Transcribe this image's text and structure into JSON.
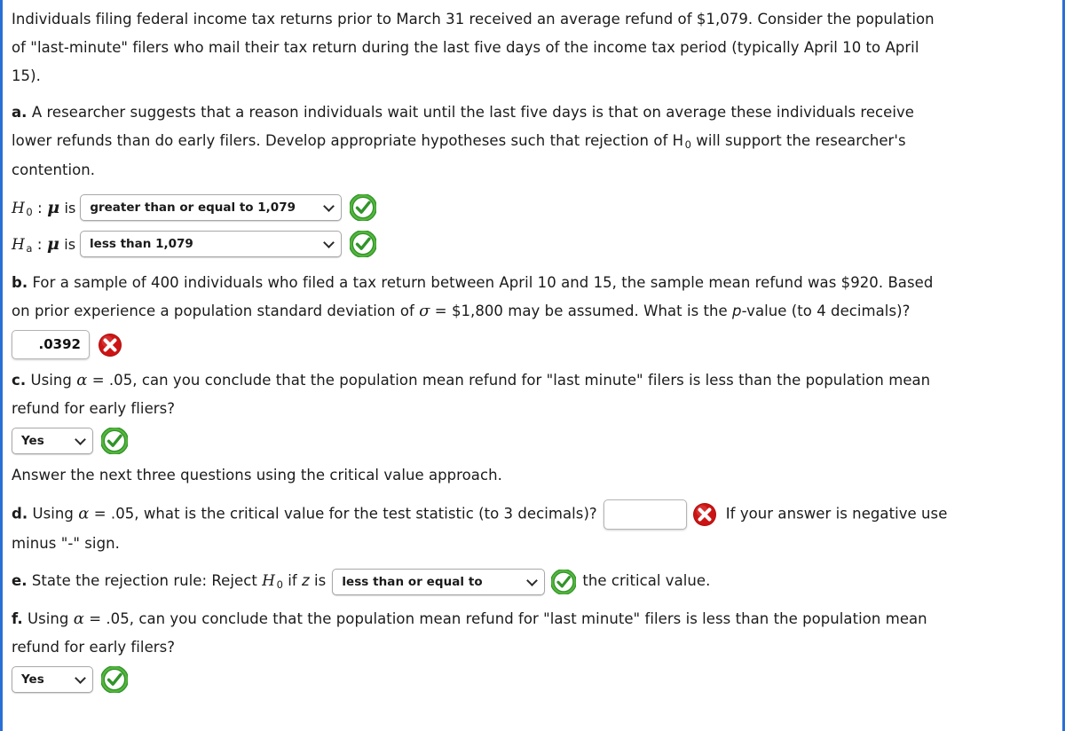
{
  "colors": {
    "page_border": "#2a6fd6",
    "correct_green": "#2f9e2f",
    "incorrect_red": "#cc1111",
    "text": "#1b1b1b"
  },
  "intro": {
    "line1": "Individuals filing federal income tax returns prior to March 31 received an average refund of $1,079. Consider the population",
    "line2": "of \"last-minute\" filers who mail their tax return during the last five days of the income tax period (typically April 10 to April",
    "line3": "15)."
  },
  "parts": {
    "a": {
      "label": "a.",
      "text_line1": "A researcher suggests that a reason individuals wait until the last five days is that on average these individuals receive",
      "text_line2_pre": "lower refunds than do early filers. Develop appropriate hypotheses such that rejection of H",
      "text_line2_sub": "0",
      "text_line2_post": " will support the researcher's",
      "text_line3": "contention.",
      "null_hypothesis": {
        "symbol": "H",
        "subscript": "0",
        "mu": "μ",
        "connector": "is",
        "value": "greater than or equal to 1,079",
        "status": "correct"
      },
      "alt_hypothesis": {
        "symbol": "H",
        "subscript": "a",
        "mu": "μ",
        "connector": "is",
        "value": "less than 1,079",
        "status": "correct"
      }
    },
    "b": {
      "label": "b.",
      "text_line1": "For a sample of 400 individuals who filed a tax return between April 10 and 15, the sample mean refund was $920. Based",
      "text_line2_pre": "on prior experience a population standard deviation of ",
      "sigma": "σ",
      "text_line2_mid": " = $1,800 may be assumed. What is the ",
      "p_italic": "p",
      "text_line2_post": "-value (to 4 decimals)?",
      "answer_value": ".0392",
      "answer_placeholder": "",
      "status": "incorrect"
    },
    "c": {
      "label": "c.",
      "text_pre": "Using ",
      "alpha": "α",
      "text_line1_post": " = .05, can you conclude that the population mean refund for \"last minute\" filers is less than the population mean",
      "text_line2": "refund for early fliers?",
      "answer_value": "Yes",
      "status": "correct"
    },
    "critical_value_note": "Answer the next three questions using the critical value approach.",
    "d": {
      "label": "d.",
      "text_pre": "Using ",
      "alpha": "α",
      "text_mid": " = .05, what is the critical value for the test statistic (to 3 decimals)?",
      "text_after": "If your answer is negative use",
      "text_line2": "minus \"-\" sign.",
      "answer_value": "",
      "answer_placeholder": "",
      "status": "incorrect"
    },
    "e": {
      "label": "e.",
      "text_pre": "State the rejection rule: Reject ",
      "h_symbol": "H",
      "h_subscript": "0",
      "text_mid_pre": " if ",
      "z_symbol": "z",
      "text_mid_post": " is",
      "answer_value": "less than or equal to",
      "text_after": "the critical value.",
      "status": "correct"
    },
    "f": {
      "label": "f.",
      "text_pre": "Using ",
      "alpha": "α",
      "text_line1_post": " = .05, can you conclude that the population mean refund for \"last minute\" filers is less than the population mean",
      "text_line2": "refund for early filers?",
      "answer_value": "Yes",
      "status": "correct"
    }
  },
  "icons": {
    "correct": "check-circle-icon",
    "incorrect": "x-circle-icon",
    "dropdown": "chevron-down-icon"
  }
}
